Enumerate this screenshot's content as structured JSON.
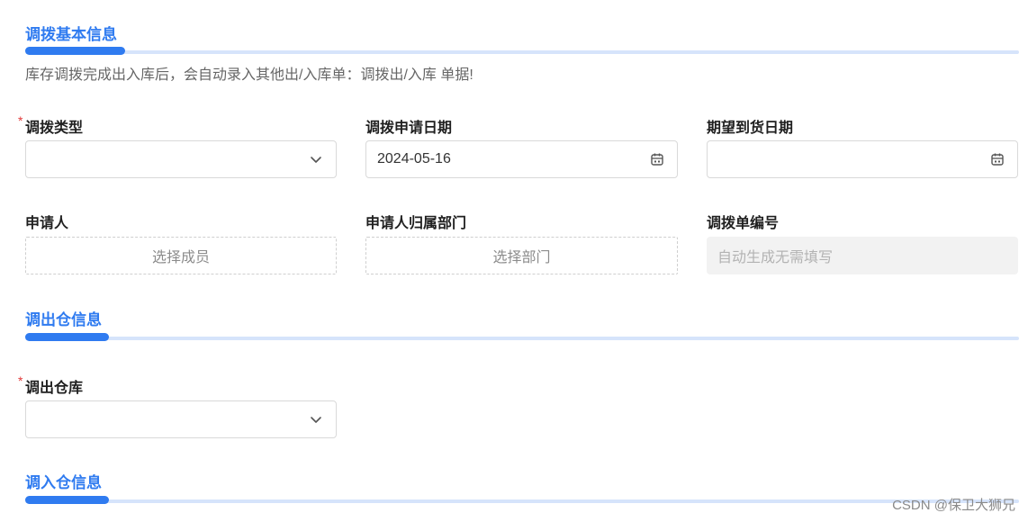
{
  "sections": {
    "basic_title": "调拨基本信息",
    "outbound_title": "调出仓信息",
    "inbound_title": "调入仓信息"
  },
  "description": "库存调拨完成出入库后，会自动录入其他出/入库单：调拨出/入库 单据!",
  "required_mark": "*",
  "fields": {
    "transfer_type": {
      "label": "调拨类型",
      "value": ""
    },
    "apply_date": {
      "label": "调拨申请日期",
      "value": "2024-05-16"
    },
    "expected_date": {
      "label": "期望到货日期",
      "value": ""
    },
    "applicant": {
      "label": "申请人",
      "placeholder": "选择成员"
    },
    "applicant_dept": {
      "label": "申请人归属部门",
      "placeholder": "选择部门"
    },
    "transfer_no": {
      "label": "调拨单编号",
      "placeholder": "自动生成无需填写"
    },
    "out_warehouse": {
      "label": "调出仓库",
      "value": ""
    }
  },
  "colors": {
    "accent": "#2f7bf0",
    "accent_light": "#d6e4fb",
    "required": "#e23a3a"
  },
  "icons": {
    "select": "chevron-down-icon",
    "date": "calendar-icon"
  },
  "watermark": "CSDN @保卫大狮兄"
}
